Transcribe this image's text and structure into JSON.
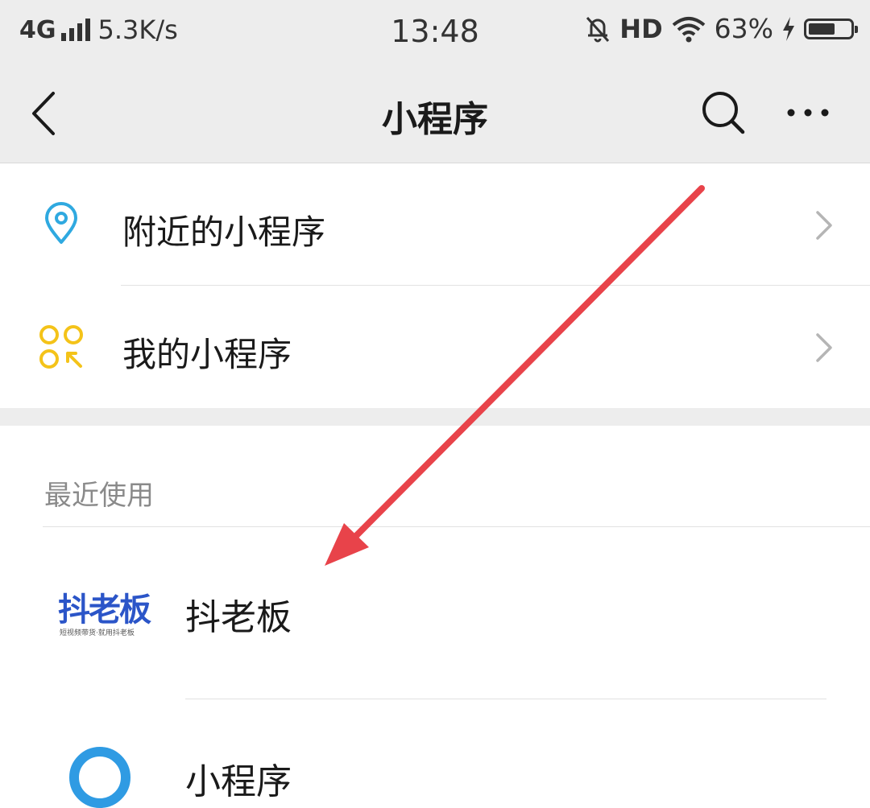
{
  "status_bar": {
    "network": "4G",
    "speed": "5.3K/s",
    "time": "13:48",
    "hd": "HD",
    "battery_percent": "63%",
    "battery_level": 0.63
  },
  "navbar": {
    "title": "小程序",
    "back_icon": "chevron-left-icon",
    "search_icon": "search-icon",
    "more_icon": "more-icon"
  },
  "menu": {
    "items": [
      {
        "label": "附近的小程序",
        "icon": "location-pin-icon",
        "color": "#2fa9e0"
      },
      {
        "label": "我的小程序",
        "icon": "mini-program-grid-icon",
        "color": "#f4c319"
      }
    ]
  },
  "recent": {
    "title": "最近使用",
    "items": [
      {
        "name": "抖老板",
        "logo_text": "抖老板",
        "logo_subtext": "短视频带货·就用抖老板",
        "logo_color": "#2b55c8"
      },
      {
        "name": "小程序",
        "logo_color": "#2f9be3"
      }
    ]
  },
  "annotation": {
    "color": "#e8434a",
    "icon": "red-arrow-annotation"
  }
}
